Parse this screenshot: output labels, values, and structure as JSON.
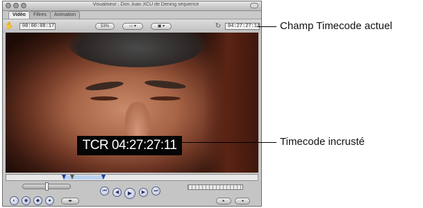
{
  "window": {
    "title": "Visualiseur : Don Juan XCU de Dening sequence",
    "tabs": [
      {
        "label": "Vidéo",
        "active": true
      },
      {
        "label": "Filtres",
        "active": false
      },
      {
        "label": "Animation",
        "active": false
      }
    ]
  },
  "toolbar": {
    "duration_timecode": "00:00:08:17",
    "zoom_label": "53%",
    "view_menu_label": "▾",
    "overlay_menu_label": "▾",
    "current_timecode": "04:27:27:11"
  },
  "video": {
    "burned_timecode": "TCR 04:27:27:11"
  },
  "transport": {
    "play_icon": "play-icon",
    "controls": [
      "go-to-in-icon",
      "previous-frame-icon",
      "play-icon",
      "next-frame-icon",
      "go-to-out-icon"
    ]
  },
  "callouts": {
    "current_timecode_field": "Champ Timecode actuel",
    "burned_in_timecode": "Timecode incrusté"
  }
}
